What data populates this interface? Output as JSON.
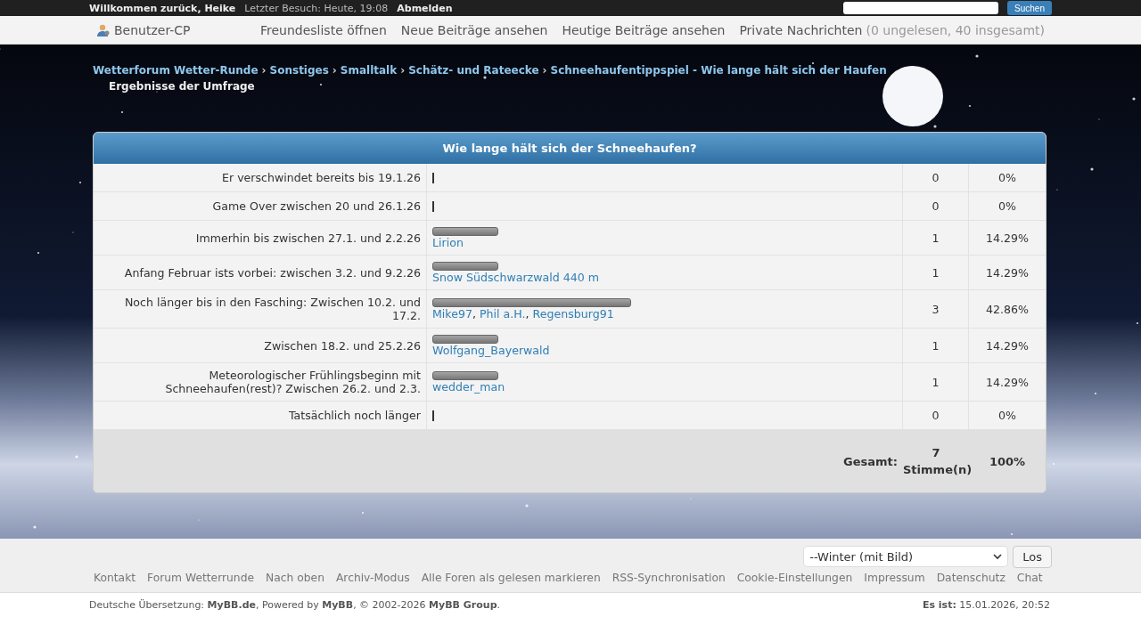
{
  "top_bar": {
    "welcome": "Willkommen zurück, Heike",
    "last_visit": "Letzter Besuch: Heute, 19:08",
    "logout": "Abmelden",
    "search_button": "Suchen"
  },
  "nav": {
    "user_cp": "Benutzer-CP",
    "links": [
      "Freundesliste öffnen",
      "Neue Beiträge ansehen",
      "Heutige Beiträge ansehen"
    ],
    "messages": "Private Nachrichten",
    "messages_count": "(0 ungelesen, 40 insgesamt)"
  },
  "breadcrumb": [
    "Wetterforum Wetter-Runde",
    "Sonstiges",
    "Smalltalk",
    "Schätz- und Rateecke",
    "Schneehaufentippspiel - Wie lange hält sich der Haufen"
  ],
  "breadcrumb_separator": "›",
  "page_title": "Ergebnisse der Umfrage",
  "poll": {
    "title": "Wie lange hält sich der Schneehaufen?",
    "options": [
      {
        "label": "Er verschwindet bereits bis 19.1.26",
        "level": 0,
        "votes": "0",
        "percent": "0%"
      },
      {
        "label": "Game Over zwischen 20 und 26.1.26",
        "level": 0,
        "votes": "0",
        "percent": "0%"
      },
      {
        "label": "Immerhin bis zwischen 27.1. und 2.2.26",
        "level": 0.1429,
        "voters": [
          "Lirion"
        ],
        "votes": "1",
        "percent": "14.29%"
      },
      {
        "label": "Anfang Februar ists vorbei: zwischen 3.2. und 9.2.26",
        "level": 0.1429,
        "voters": [
          "Snow Südschwarzwald 440 m"
        ],
        "votes": "1",
        "percent": "14.29%"
      },
      {
        "label": "Noch länger bis in den Fasching: Zwischen 10.2. und 17.2.",
        "level": 0.4286,
        "voters": [
          "Mike97",
          "Phil a.H.",
          "Regensburg91"
        ],
        "votes": "3",
        "percent": "42.86%"
      },
      {
        "label": "Zwischen 18.2. und 25.2.26",
        "level": 0.1429,
        "voters": [
          "Wolfgang_Bayerwald"
        ],
        "votes": "1",
        "percent": "14.29%"
      },
      {
        "label": "Meteorologischer Frühlingsbeginn mit Schneehaufen(rest)? Zwischen 26.2. und 2.3.",
        "level": 0.1429,
        "voters": [
          "wedder_man"
        ],
        "votes": "1",
        "percent": "14.29%"
      },
      {
        "label": "Tatsächlich noch länger",
        "level": 0,
        "votes": "0",
        "percent": "0%"
      }
    ],
    "voter_separator": ",",
    "total_label": "Gesamt:",
    "total_votes": "7 Stimme(n)",
    "total_percent": "100%"
  },
  "theme_select": {
    "value": "--Winter (mit Bild)",
    "button": "Los"
  },
  "footer_links": [
    "Kontakt",
    "Forum Wetterrunde",
    "Nach oben",
    "Archiv-Modus",
    "Alle Foren als gelesen markieren",
    "RSS-Synchronisation",
    "Cookie-Einstellungen",
    "Impressum",
    "Datenschutz",
    "Chat"
  ],
  "credits": "Deutsche Übersetzung: **MyBB.de**, Powered by **MyBB**, © 2002-2026 **MyBB Group**.",
  "clock": "**Es ist:** 15.01.2026, 20:52"
}
